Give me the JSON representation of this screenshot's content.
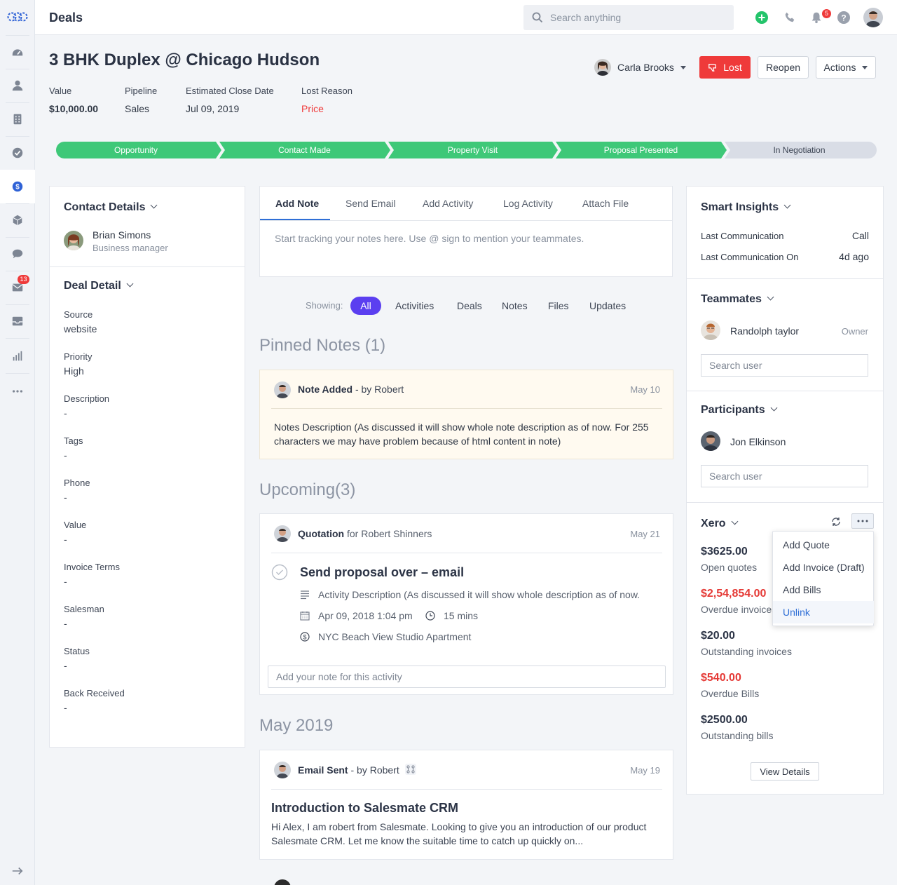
{
  "header": {
    "title": "Deals",
    "search_placeholder": "Search anything",
    "notification_count": "5"
  },
  "sidebar": {
    "items": [
      {
        "name": "dashboard-icon"
      },
      {
        "name": "contacts-icon"
      },
      {
        "name": "companies-icon"
      },
      {
        "name": "activities-icon"
      },
      {
        "name": "deals-icon",
        "active": true
      },
      {
        "name": "products-icon"
      },
      {
        "name": "chat-icon"
      },
      {
        "name": "email-icon",
        "badge": "13"
      },
      {
        "name": "inbox-icon"
      },
      {
        "name": "reports-icon"
      },
      {
        "name": "more-icon"
      }
    ]
  },
  "deal": {
    "title": "3 BHK Duplex @ Chicago Hudson",
    "owner": "Carla Brooks",
    "lost_label": "Lost",
    "reopen_label": "Reopen",
    "actions_label": "Actions",
    "meta": [
      {
        "label": "Value",
        "value": "$10,000.00"
      },
      {
        "label": "Pipeline",
        "value": "Sales"
      },
      {
        "label": "Estimated Close Date",
        "value": "Jul 09, 2019"
      },
      {
        "label": "Lost Reason",
        "value": "Price"
      }
    ]
  },
  "pipeline": {
    "stages": [
      "Opportunity",
      "Contact Made",
      "Property Visit",
      "Proposal Presented",
      "In Negotiation"
    ],
    "completed_count": 4
  },
  "contact": {
    "title": "Contact Details",
    "name": "Brian Simons",
    "role": "Business manager"
  },
  "deal_detail": {
    "title": "Deal Detail",
    "fields": [
      {
        "label": "Source",
        "value": "website"
      },
      {
        "label": "Priority",
        "value": "High"
      },
      {
        "label": "Description",
        "value": "-"
      },
      {
        "label": "Tags",
        "value": "-"
      },
      {
        "label": "Phone",
        "value": "-"
      },
      {
        "label": "Value",
        "value": "-"
      },
      {
        "label": "Invoice Terms",
        "value": "-"
      },
      {
        "label": "Salesman",
        "value": "-"
      },
      {
        "label": "Status",
        "value": "-"
      },
      {
        "label": "Back Received",
        "value": "-"
      }
    ]
  },
  "composer": {
    "tabs": [
      "Add Note",
      "Send Email",
      "Add Activity",
      "Log Activity",
      "Attach File"
    ],
    "active_tab": "Add Note",
    "placeholder": "Start tracking your notes here. Use @ sign to mention your teammates."
  },
  "filters": {
    "label": "Showing:",
    "items": [
      "All",
      "Activities",
      "Deals",
      "Notes",
      "Files",
      "Updates"
    ],
    "active": "All"
  },
  "pinned": {
    "heading": "Pinned Notes (1)",
    "note": {
      "title": "Note Added",
      "by": "- by Robert",
      "date": "May 10",
      "body": "Notes Description (As discussed it will show whole note description as of now. For 255 characters we may have problem because of html content in note)"
    }
  },
  "upcoming": {
    "heading": "Upcoming(3)",
    "item": {
      "type": "Quotation",
      "for_text": "for Robert Shinners",
      "date": "May 21",
      "title": "Send proposal over – email",
      "description": "Activity Description (As discussed it will show whole description as of now.",
      "datetime": "Apr 09, 2018 1:04 pm",
      "duration": "15 mins",
      "deal": "NYC Beach View Studio Apartment",
      "note_placeholder": "Add your note for this activity"
    }
  },
  "history": {
    "heading": "May 2019",
    "email": {
      "title": "Email Sent",
      "by": "- by Robert",
      "date": "May 19",
      "subject": "Introduction to Salesmate CRM",
      "body": "Hi Alex, I am robert from Salesmate. Looking to give you an introduction of our product Salesmate CRM. Let me know the suitable time to catch up quickly on..."
    }
  },
  "insights": {
    "title": "Smart Insights",
    "rows": [
      {
        "label": "Last Communication",
        "value": "Call"
      },
      {
        "label": "Last Communication On",
        "value": "4d ago"
      }
    ]
  },
  "teammates": {
    "title": "Teammates",
    "member": {
      "name": "Randolph taylor",
      "role": "Owner"
    },
    "search_placeholder": "Search user"
  },
  "participants": {
    "title": "Participants",
    "member": {
      "name": "Jon Elkinson"
    },
    "search_placeholder": "Search user"
  },
  "xero": {
    "title": "Xero",
    "items": [
      {
        "amount": "$3625.00",
        "label": "Open quotes",
        "overdue": false
      },
      {
        "amount": "$2,54,854.00",
        "label": "Overdue invoices",
        "overdue": true
      },
      {
        "amount": "$20.00",
        "label": "Outstanding invoices",
        "overdue": false
      },
      {
        "amount": "$540.00",
        "label": "Overdue Bills",
        "overdue": true
      },
      {
        "amount": "$2500.00",
        "label": "Outstanding bills",
        "overdue": false
      }
    ],
    "view_details_label": "View Details",
    "menu": [
      "Add Quote",
      "Add Invoice (Draft)",
      "Add Bills",
      "Unlink"
    ],
    "colors": {
      "overdue": "#e53935",
      "link": "#2f6fd6"
    }
  },
  "colors": {
    "accent": "#5b3ff0",
    "stage_done": "#3ec878",
    "stage_pending": "#d9dde6",
    "lost": "#ef3a3a"
  }
}
